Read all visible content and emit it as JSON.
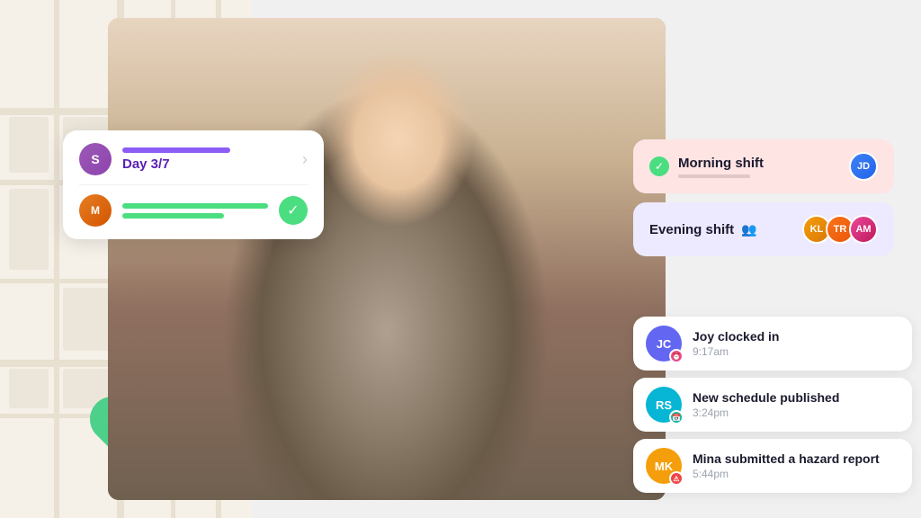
{
  "map": {
    "label": "map-background"
  },
  "day_card": {
    "avatar_label": "S",
    "day_label": "Day 3/7",
    "chevron": "›",
    "task_avatar_label": "M"
  },
  "shifts": {
    "morning": {
      "name": "Morning shift",
      "check": "✓"
    },
    "evening": {
      "name": "Evening shift",
      "people_icon": "👥"
    }
  },
  "notifications": [
    {
      "avatar_label": "JC",
      "avatar_color": "#6366f1",
      "badge_color": "badge-pink",
      "badge_icon": "⏰",
      "title": "Joy clocked in",
      "time": "9:17am"
    },
    {
      "avatar_label": "RS",
      "avatar_color": "#06b6d4",
      "badge_color": "badge-teal",
      "badge_icon": "📅",
      "title": "New schedule published",
      "time": "3:24pm"
    },
    {
      "avatar_label": "MK",
      "avatar_color": "#f59e0b",
      "badge_color": "badge-red",
      "badge_icon": "⚠",
      "title": "Mina submitted a hazard report",
      "time": "5:44pm"
    }
  ]
}
